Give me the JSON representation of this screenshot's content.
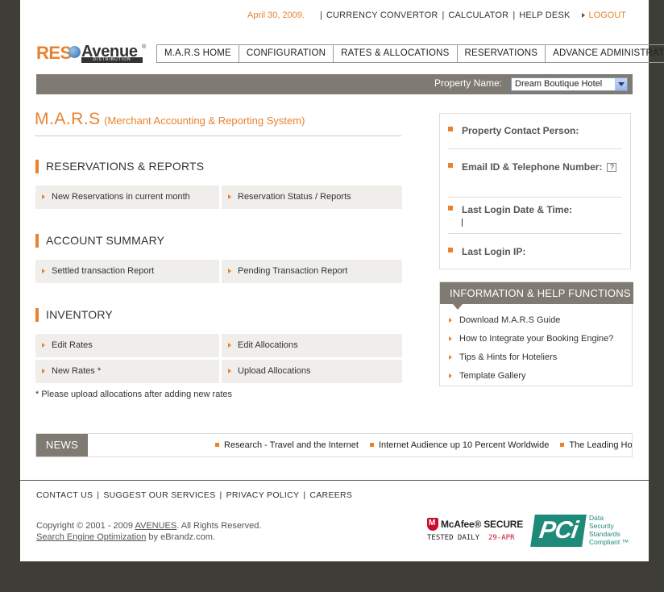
{
  "top": {
    "date": "April 30, 2009.",
    "links": [
      "CURRENCY CONVERTOR",
      "CALCULATOR",
      "HELP DESK"
    ],
    "logout": "LOGOUT"
  },
  "logo": {
    "reso": "RES",
    "avenue": "Avenue",
    "reg": "®",
    "dist": "DISTRIBUTION"
  },
  "nav": [
    "M.A.R.S HOME",
    "CONFIGURATION",
    "RATES & ALLOCATIONS",
    "RESERVATIONS",
    "ADVANCE ADMINISTRATION"
  ],
  "property": {
    "label": "Property Name:",
    "value": "Dream Boutique Hotel"
  },
  "mars": {
    "title": "M.A.R.S",
    "subtitle": "(Merchant Accounting & Reporting System)"
  },
  "sections": {
    "reservations": {
      "title": "RESERVATIONS & REPORTS",
      "items": [
        "New Reservations in current month",
        "Reservation Status / Reports"
      ]
    },
    "account": {
      "title": "ACCOUNT SUMMARY",
      "items": [
        "Settled transaction Report",
        "Pending Transaction Report"
      ]
    },
    "inventory": {
      "title": "INVENTORY",
      "items": [
        "Edit Rates",
        "Edit Allocations",
        "New Rates *",
        "Upload Allocations"
      ]
    }
  },
  "note": "* Please upload allocations after adding new rates",
  "info": {
    "contact": "Property Contact Person:",
    "email": "Email ID & Telephone Number:",
    "qmark": "?",
    "login_date": "Last Login Date & Time:",
    "login_ip": "Last Login IP:"
  },
  "help": {
    "title": "INFORMATION & HELP FUNCTIONS",
    "items": [
      "Download M.A.R.S Guide",
      "How to Integrate your Booking Engine?",
      "Tips & Hints for Hoteliers",
      "Template Gallery"
    ]
  },
  "news": {
    "label": "NEWS",
    "items": [
      "Research - Travel and the Internet",
      "Internet Audience up 10 Percent Worldwide",
      "The Leading Hot"
    ]
  },
  "footer": {
    "links": [
      "CONTACT US",
      "SUGGEST OUR SERVICES",
      "PRIVACY POLICY",
      "CAREERS"
    ],
    "copy_prefix": "Copyright © 2001 - 2009 ",
    "copy_link": "AVENUES",
    "copy_suffix": ". All Rights Reserved.",
    "seo_link": "Search Engine Optimization",
    "seo_suffix": " by eBrandz.com."
  },
  "badges": {
    "mcafee_name": "McAfee® SECURE",
    "mcafee_tested": "TESTED DAILY",
    "mcafee_date": "29-APR",
    "pci_logo": "PCi",
    "pci_text": [
      "Data",
      "Security",
      "Standards",
      "Compliant ™"
    ]
  }
}
